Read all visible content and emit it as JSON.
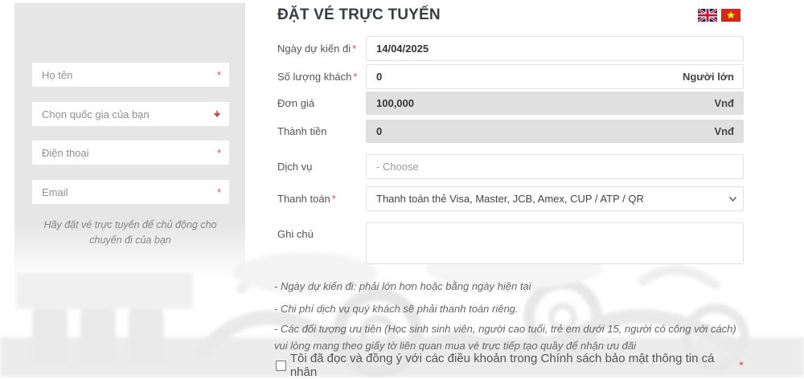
{
  "page": {
    "title": "ĐẶT VÉ TRỰC TUYẾN"
  },
  "language_switcher": {
    "english": "English",
    "vietnamese": "Tiếng Việt"
  },
  "sidebar": {
    "fields": [
      {
        "placeholder": "Họ tên",
        "required_mark": "*"
      },
      {
        "placeholder": "Chọn quốc gia của bạn"
      },
      {
        "placeholder": "Điện thoại",
        "required_mark": "*"
      },
      {
        "placeholder": "Email",
        "required_mark": "*"
      }
    ],
    "note": "Hãy đặt vé trực tuyến để chủ động cho chuyến đi của bạn"
  },
  "form": {
    "rows": [
      {
        "label": "Ngày dự kiến đi",
        "required_mark": "*",
        "value": "14/04/2025"
      },
      {
        "label": "Số lượng khách",
        "required_mark": "*",
        "value": "0",
        "suffix": "Người lớn"
      },
      {
        "label": "Đơn giá",
        "value": "100,000",
        "suffix": "Vnđ"
      },
      {
        "label": "Thành tiền",
        "value": "0",
        "suffix": "Vnđ"
      },
      {
        "label": "Dịch vụ",
        "placeholder": "- Choose"
      },
      {
        "label": "Thanh toán",
        "required_mark": "*",
        "value": "Thanh toán thẻ Visa, Master, JCB, Amex, CUP / ATP / QR"
      },
      {
        "label": "Ghi chú"
      }
    ],
    "notes": [
      "- Ngày dự kiến đi: phải lớn hơn hoặc bằng ngày hiện tại",
      "- Chi phí dịch vụ quý khách sẽ phải thanh toán riêng.",
      "- Các đối tượng ưu tiên (Học sinh sinh viên, người cao tuổi, trẻ em dưới 15, người có công với cách) vui lòng mang theo giấy tờ liên quan mua vé trực tiếp tạo quầy để nhận ưu đãi"
    ],
    "agreement": {
      "text": "Tôi đã đọc và đồng ý với các điều khoản trong Chính sách bảo mật thông tin cá nhân",
      "required_mark": "*"
    }
  },
  "colors": {
    "required": "#d9534f",
    "sidebar_bg": "#e6e6e6",
    "disabled_bg": "#e0e0e0",
    "flag_vn_red": "#da251d",
    "flag_uk_blue": "#012169"
  }
}
